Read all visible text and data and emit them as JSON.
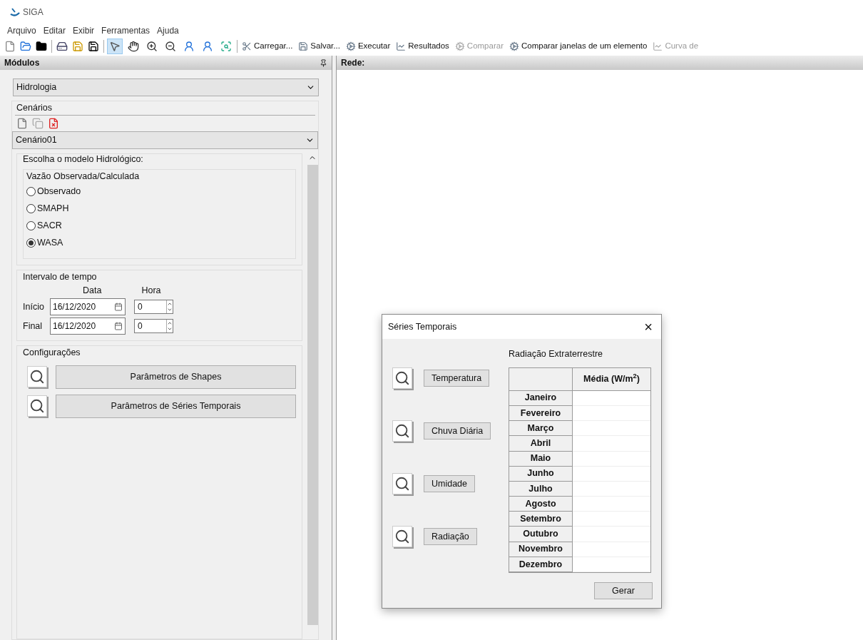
{
  "window": {
    "title": "SIGA"
  },
  "menu": [
    "Arquivo",
    "Editar",
    "Exibir",
    "Ferramentas",
    "Ajuda"
  ],
  "toolbar": {
    "tools": [
      {
        "kind": "pointer",
        "selected": true
      },
      {
        "kind": "pan",
        "selected": false
      },
      {
        "kind": "zoom-in",
        "selected": false
      },
      {
        "kind": "zoom-out",
        "selected": false
      },
      {
        "kind": "user-left",
        "selected": false
      },
      {
        "kind": "user-right",
        "selected": false
      },
      {
        "kind": "fit",
        "selected": false
      }
    ],
    "actions": [
      {
        "label": "Carregar...",
        "disabled": false
      },
      {
        "label": "Salvar...",
        "disabled": false
      },
      {
        "label": "Executar",
        "disabled": false
      },
      {
        "label": "Resultados",
        "disabled": false
      },
      {
        "label": "Comparar",
        "disabled": true
      },
      {
        "label": "Comparar janelas de um elemento",
        "disabled": false
      },
      {
        "label": "Curva de",
        "disabled": true
      }
    ]
  },
  "modules_panel": {
    "title": "Módulos",
    "module": "Hidrologia",
    "scenarios_title": "Cenários",
    "scenario": "Cenário01",
    "model_group": "Escolha o modelo Hidrológico:",
    "flow_group": "Vazão Observada/Calculada",
    "models": [
      {
        "label": "Observado",
        "selected": false
      },
      {
        "label": "SMAPH",
        "selected": false
      },
      {
        "label": "SACR",
        "selected": false
      },
      {
        "label": "WASA",
        "selected": true
      }
    ],
    "interval_title": "Intervalo de tempo",
    "date_header": "Data",
    "hour_header": "Hora",
    "interval_rows": [
      {
        "label": "Início",
        "date": "16/12/2020",
        "hour": "0"
      },
      {
        "label": "Final",
        "date": "16/12/2020",
        "hour": "0"
      }
    ],
    "config_title": "Configurações",
    "config_buttons": [
      "Parâmetros de Shapes",
      "Parâmetros de Séries Temporais"
    ]
  },
  "network_panel": {
    "title": "Rede:"
  },
  "dialog": {
    "title": "Séries Temporais",
    "close": "×",
    "series_buttons": [
      "Temperatura",
      "Chuva Diária",
      "Umidade",
      "Radiação"
    ],
    "table_title": "Radiação Extraterrestre",
    "column": "Média (W/m$^{2}$)",
    "months": [
      "Janeiro",
      "Fevereiro",
      "Março",
      "Abril",
      "Maio",
      "Junho",
      "Julho",
      "Agosto",
      "Setembro",
      "Outubro",
      "Novembro",
      "Dezembro"
    ],
    "generate": "Gerar"
  }
}
